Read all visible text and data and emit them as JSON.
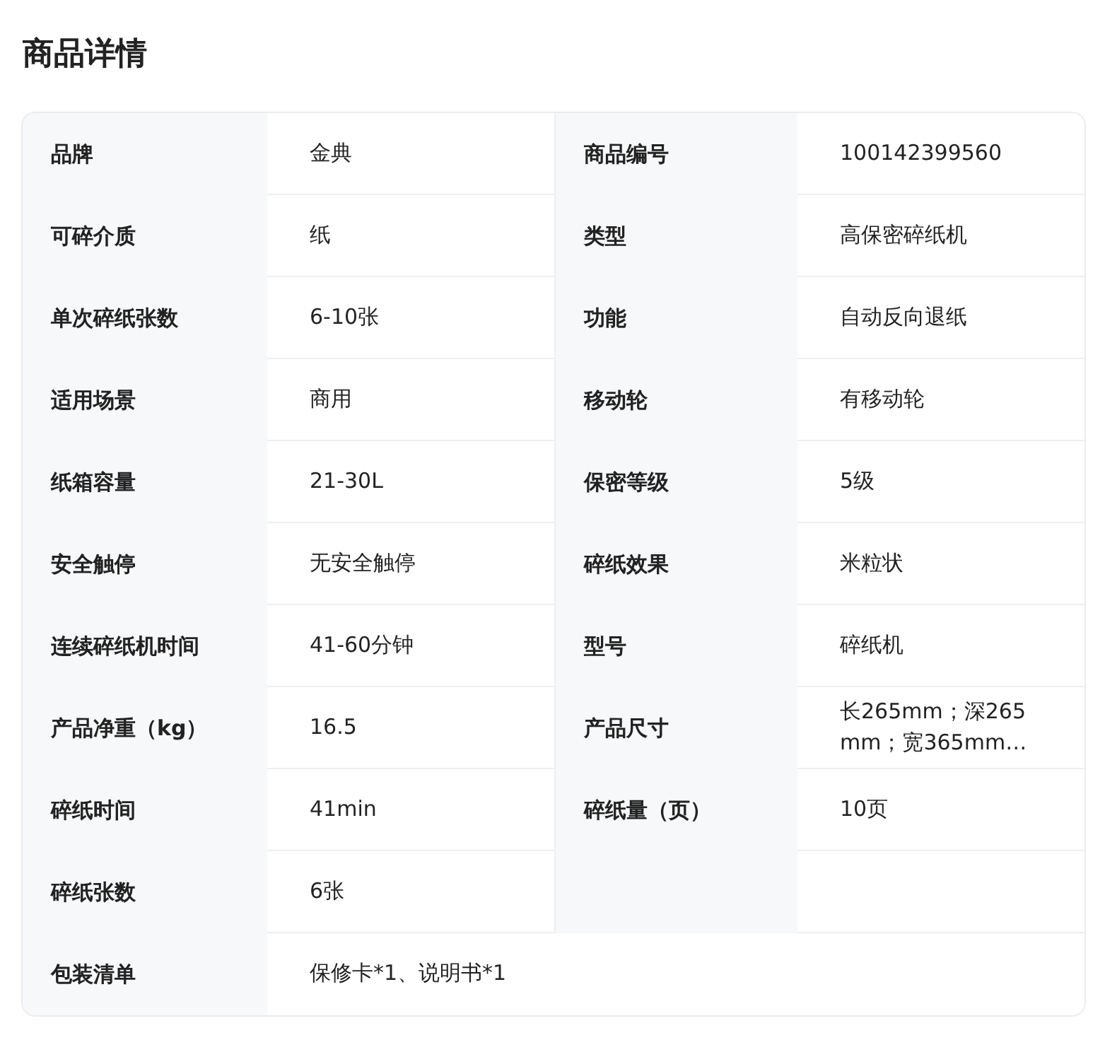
{
  "title": "商品详情",
  "rows": [
    {
      "kind": "double",
      "pairs": [
        {
          "label": "品牌",
          "value": "金典"
        },
        {
          "label": "商品编号",
          "value": "100142399560"
        }
      ]
    },
    {
      "kind": "double",
      "pairs": [
        {
          "label": "可碎介质",
          "value": "纸"
        },
        {
          "label": "类型",
          "value": "高保密碎纸机"
        }
      ]
    },
    {
      "kind": "double",
      "pairs": [
        {
          "label": "单次碎纸张数",
          "value": "6-10张"
        },
        {
          "label": "功能",
          "value": "自动反向退纸"
        }
      ]
    },
    {
      "kind": "double",
      "pairs": [
        {
          "label": "适用场景",
          "value": "商用"
        },
        {
          "label": "移动轮",
          "value": "有移动轮"
        }
      ]
    },
    {
      "kind": "double",
      "pairs": [
        {
          "label": "纸箱容量",
          "value": "21-30L"
        },
        {
          "label": "保密等级",
          "value": "5级"
        }
      ]
    },
    {
      "kind": "double",
      "pairs": [
        {
          "label": "安全触停",
          "value": "无安全触停"
        },
        {
          "label": "碎纸效果",
          "value": "米粒状"
        }
      ]
    },
    {
      "kind": "double",
      "pairs": [
        {
          "label": "连续碎纸机时间",
          "value": "41-60分钟"
        },
        {
          "label": "型号",
          "value": "碎纸机"
        }
      ]
    },
    {
      "kind": "double",
      "pairs": [
        {
          "label": "产品净重（kg）",
          "value": "16.5"
        },
        {
          "label": "产品尺寸",
          "value": "长265mm；深265mm；宽365mm…"
        }
      ]
    },
    {
      "kind": "double",
      "pairs": [
        {
          "label": "碎纸时间",
          "value": "41min"
        },
        {
          "label": "碎纸量（页）",
          "value": "10页"
        }
      ]
    },
    {
      "kind": "double",
      "pairs": [
        {
          "label": "碎纸张数",
          "value": "6张"
        }
      ]
    },
    {
      "kind": "wide",
      "pairs": [
        {
          "label": "包装清单",
          "value": "保修卡*1、说明书*1"
        }
      ]
    }
  ]
}
